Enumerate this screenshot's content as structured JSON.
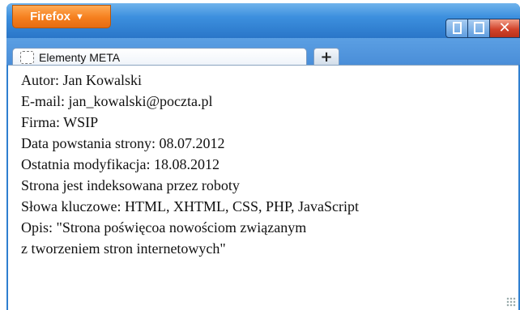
{
  "browser": {
    "menu_button_label": "Firefox",
    "menu_button_arrow": "▼",
    "tab": {
      "title": "Elementy META",
      "icon": "blank-page-icon"
    },
    "new_tab_label": "+",
    "window_controls": {
      "minimize": "minimize-icon",
      "maximize": "maximize-icon",
      "close": "close-icon",
      "close_glyph": "✕"
    },
    "colors": {
      "titlebar": "#3c8fde",
      "menu_button": "#f57f1e",
      "close_button": "#d2442b"
    }
  },
  "page": {
    "lines": [
      "Autor: Jan Kowalski",
      "E-mail: jan_kowalski@poczta.pl",
      "Firma: WSIP",
      "Data powstania strony: 08.07.2012",
      "Ostatnia modyfikacja: 18.08.2012",
      "Strona jest indeksowana przez roboty",
      "Słowa kluczowe: HTML, XHTML, CSS, PHP, JavaScript",
      "Opis: \"Strona poświęcoa nowościom związanym",
      "z tworzeniem stron internetowych\""
    ]
  }
}
